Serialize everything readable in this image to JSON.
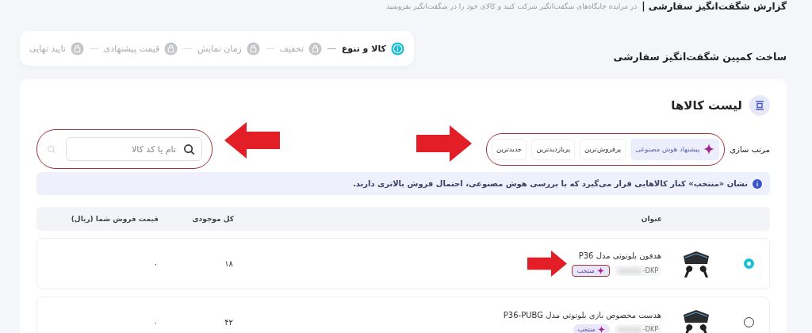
{
  "header": {
    "title": "گزارش شگفت‌انگیز سفارشی |",
    "subtitle": "در مزایده جایگاه‌های شگفت‌انگیز شرکت کنید و کالای خود را در شگفت‌انگیز بفروشید"
  },
  "page_title": "ساخت کمپین شگفت‌انگیز سفارشی",
  "steps": [
    {
      "label": "کالا و تنوع",
      "selected": true
    },
    {
      "label": "تخفیف",
      "selected": false
    },
    {
      "label": "زمان نمایش",
      "selected": false
    },
    {
      "label": "قیمت پیشنهادی",
      "selected": false
    },
    {
      "label": "تایید نهایی",
      "selected": false
    }
  ],
  "list_title": "لیست کالاها",
  "sort": {
    "label": "مرتب سازی",
    "options": [
      {
        "label": "پیشنهاد هوش مصنوعی",
        "kind": "ai",
        "selected": true
      },
      {
        "label": "پرفروش‌ترین",
        "kind": "plain",
        "selected": false
      },
      {
        "label": "پربازدیدترین",
        "kind": "plain",
        "selected": false
      },
      {
        "label": "جدیدترین",
        "kind": "plain",
        "selected": false
      }
    ]
  },
  "search": {
    "placeholder": "نام یا کد کالا"
  },
  "notice": "نشان «منتخب» کنار کالاهایی قرار می‌گیرد که با بررسی هوش مصنوعی، احتمال فروش بالاتری دارند.",
  "table": {
    "columns": [
      "عنوان",
      "کل موجودی",
      "قیمت فروش شما (ریال)"
    ],
    "rows": [
      {
        "selected": true,
        "title": "هدفون بلوتوثی مدل P36",
        "code": "DKP-",
        "badge": "منتخب",
        "stock": "۱۸",
        "price": "۰"
      },
      {
        "selected": false,
        "title": "هدست مخصوص بازی بلوتوثی مدل P36-PUBG",
        "code": "DKP-",
        "badge": "منتخب",
        "stock": "۴۲",
        "price": "۰"
      }
    ]
  }
}
